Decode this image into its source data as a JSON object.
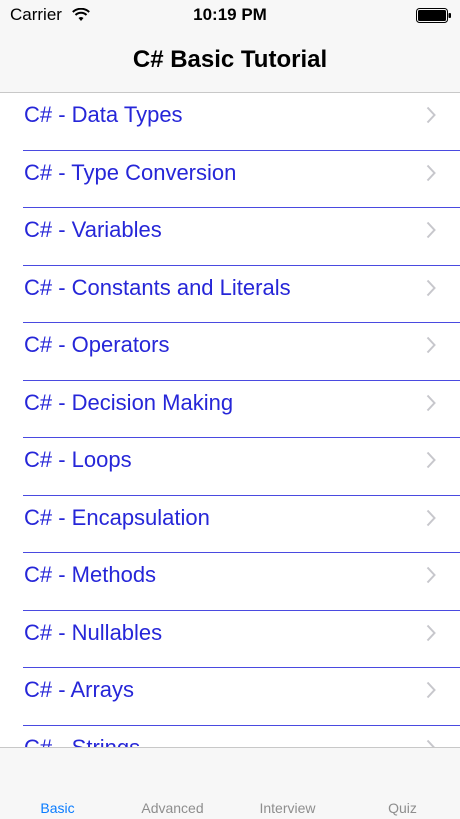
{
  "status_bar": {
    "carrier": "Carrier",
    "time": "10:19 PM"
  },
  "nav": {
    "title": "C# Basic Tutorial"
  },
  "list": {
    "items": [
      "C# - Data Types",
      "C# - Type Conversion",
      "C# - Variables",
      "C# - Constants and Literals",
      "C# - Operators",
      "C# - Decision Making",
      "C# - Loops",
      "C# - Encapsulation",
      "C# - Methods",
      "C# - Nullables",
      "C# - Arrays",
      "C# - Strings"
    ]
  },
  "tabs": [
    {
      "label": "Basic",
      "active": true
    },
    {
      "label": "Advanced",
      "active": false
    },
    {
      "label": "Interview",
      "active": false
    },
    {
      "label": "Quiz",
      "active": false
    }
  ],
  "colors": {
    "link": "#2626d8",
    "separator": "#4a4ae0",
    "tab_active": "#0a7cff",
    "tab_inactive": "#8e8e8e"
  }
}
